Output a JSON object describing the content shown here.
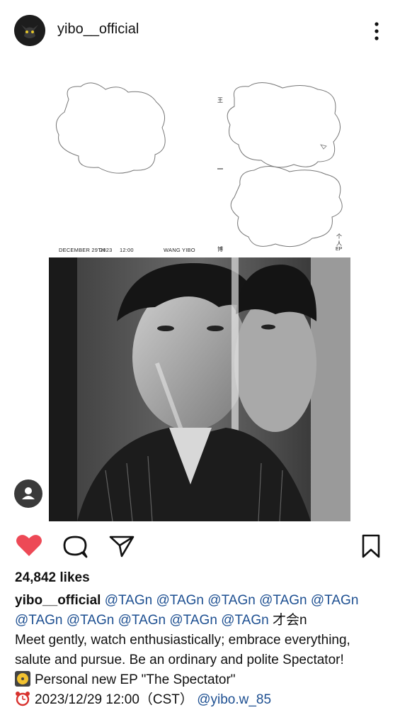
{
  "header": {
    "username": "yibo__official"
  },
  "cover": {
    "date_label": "DECEMBER 29TH",
    "year_label": "2023",
    "time_label": "12:00",
    "artist_label": "WANG YIBO",
    "side_chars": [
      "王",
      "一",
      "博"
    ],
    "ep_chars": [
      "个",
      "人"
    ],
    "ep_label": "EP"
  },
  "actions": {
    "liked": true,
    "like_color": "#ed4956"
  },
  "post": {
    "likes": "24,842 likes",
    "author": "yibo__official",
    "line1_mentions": [
      "@TAGn",
      "@TAGn",
      "@TAGn",
      "@TAGn",
      "@TAGn"
    ],
    "line2_mentions": [
      "@TAGn",
      "@TAGn",
      "@TAGn",
      "@TAGn",
      "@TAGn"
    ],
    "line2_suffix": "才会n",
    "line3": "Meet gently, watch enthusiastically; embrace everything,",
    "line4": "salute and pursue. Be an ordinary and polite Spectator!",
    "line5": "Personal new EP \"The Spectator\"",
    "line6_text": "2023/12/29 12:00（CST）",
    "line6_mention": "@yibo.w_85"
  },
  "colors": {
    "mention": "#1d4f91",
    "text": "#111111"
  }
}
